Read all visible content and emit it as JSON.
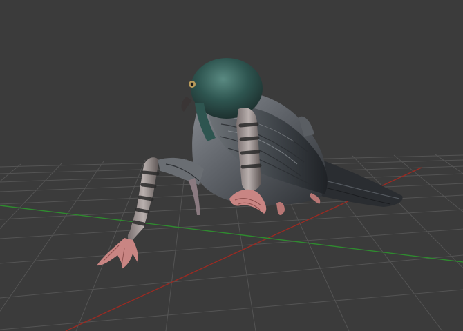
{
  "viewport": {
    "background_color": "#3b3b3b",
    "grid_color": "#545454",
    "x_axis_color": "#9b2a22",
    "y_axis_color": "#2f8a2f",
    "grid_visible": true
  },
  "model": {
    "subject": "pigeon-3d-model",
    "head_color": "#2f4f4a",
    "body_color": "#5c6066",
    "wing_color": "#3e4349",
    "leg_color": "#c97f7f",
    "feather_stripe_color": "#2a2a2a"
  }
}
